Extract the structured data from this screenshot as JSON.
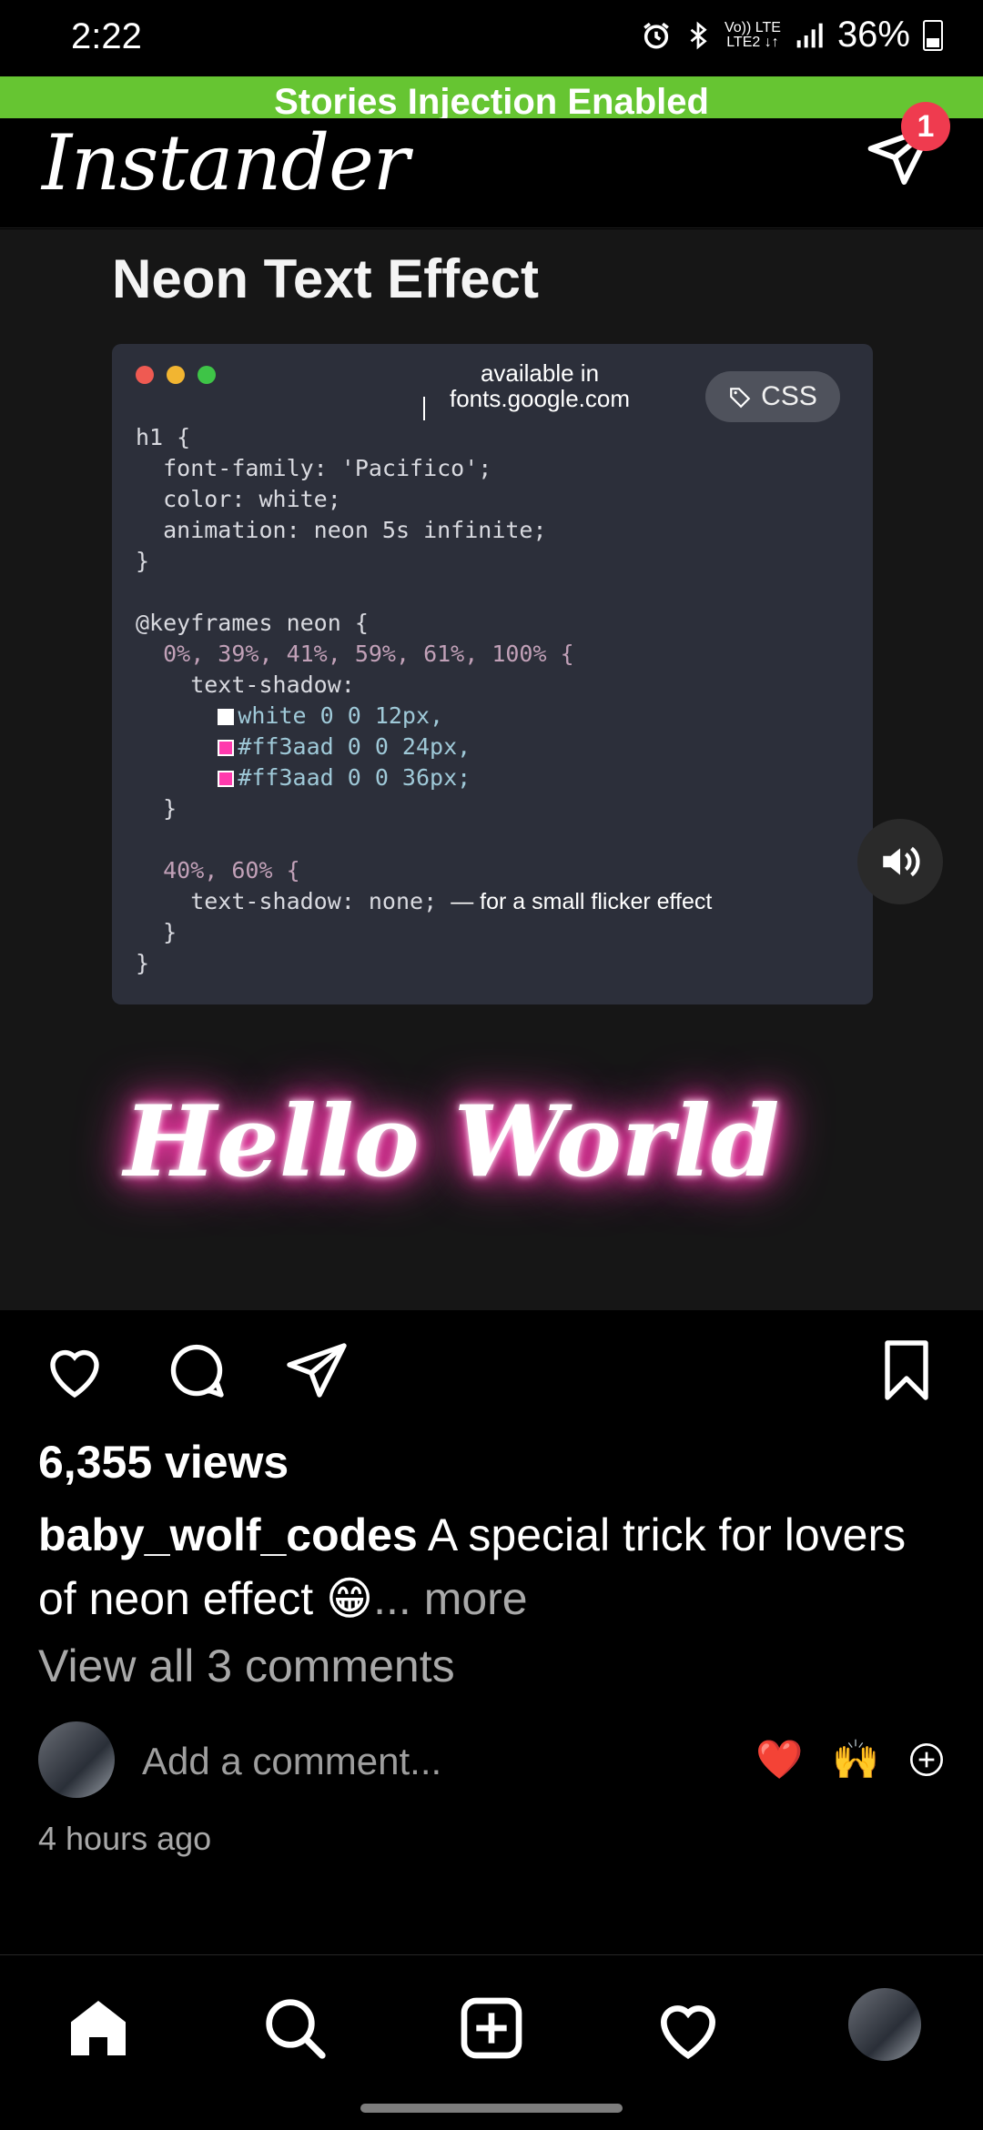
{
  "status_bar": {
    "time": "2:22",
    "network_top": "Vo)) LTE",
    "network_bottom": "LTE2 ↓↑",
    "battery": "36%"
  },
  "banner": {
    "text": "Stories Injection Enabled"
  },
  "header": {
    "logo": "Instander",
    "dm_badge": "1"
  },
  "post_media": {
    "title": "Neon Text Effect",
    "code_card": {
      "available_line1": "available in",
      "available_line2": "fonts.google.com",
      "tag_label": "CSS",
      "lines": [
        "h1 {",
        "  font-family: 'Pacifico';",
        "  color: white;",
        "  animation: neon 5s infinite;",
        "}",
        "",
        "@keyframes neon {",
        "  0%, 39%, 41%, 59%, 61%, 100% {",
        "    text-shadow:",
        "white 0 0 12px,",
        "#ff3aad 0 0 24px,",
        "#ff3aad 0 0 36px;",
        "  }",
        "",
        "  40%, 60% {",
        "    text-shadow: none;",
        "  }",
        "}"
      ],
      "flicker_note": "— for a small flicker effect"
    },
    "neon_text": "Hello World",
    "colors": {
      "neon_pink": "#ff3aad",
      "card_bg": "#2c2f3a"
    }
  },
  "actions": {
    "views": "6,355 views"
  },
  "caption": {
    "username": "baby_wolf_codes",
    "text": " A special trick for lovers of neon effect 😁",
    "more": "... more"
  },
  "comments": {
    "view_all": "View all 3 comments",
    "placeholder": "Add a comment...",
    "emoji_1": "❤️",
    "emoji_2": "🙌"
  },
  "timestamp": "4 hours ago",
  "colors": {
    "banner": "#66c532",
    "badge": "#ef3b4f",
    "muted_text": "#a8a8a8"
  },
  "icons": [
    "alarm-icon",
    "bluetooth-icon",
    "signal-icon",
    "battery-icon",
    "direct-message-icon",
    "tag-icon",
    "volume-icon",
    "heart-icon",
    "comment-icon",
    "share-icon",
    "bookmark-icon",
    "add-circle-icon",
    "home-icon",
    "search-icon",
    "new-post-icon",
    "activity-heart-icon"
  ]
}
